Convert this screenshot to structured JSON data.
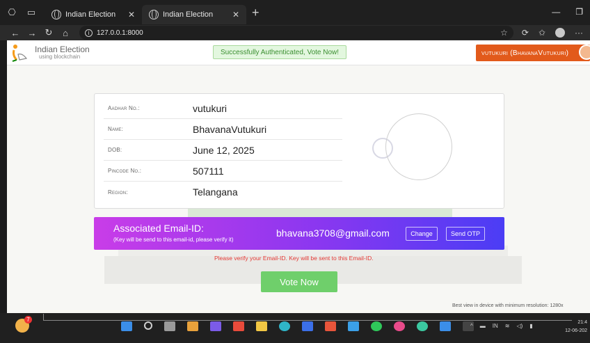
{
  "browser": {
    "tabs": [
      {
        "title": "Indian Election",
        "active": false
      },
      {
        "title": "Indian Election",
        "active": true
      }
    ],
    "url": "127.0.0.1:8000"
  },
  "header": {
    "brand_title": "Indian Election",
    "brand_subtitle": "using blockchain",
    "auth_message": "Successfully Authenticated, Vote Now!",
    "user_badge": "vutukuri (BhavanaVutukuri)"
  },
  "voter": {
    "rows": [
      {
        "label": "Aadhar No.:",
        "value": "vutukuri"
      },
      {
        "label": "Name:",
        "value": "BhavanaVutukuri"
      },
      {
        "label": "DOB:",
        "value": "June 12, 2025"
      },
      {
        "label": "Pincode No.:",
        "value": "507111"
      },
      {
        "label": "Region:",
        "value": "Telangana"
      }
    ]
  },
  "email": {
    "title": "Associated Email-ID:",
    "note": "(Key will be send to this email-id, please verify it)",
    "value": "bhavana3708@gmail.com",
    "change_label": "Change",
    "otp_label": "Send OTP"
  },
  "warning": "Please verify your Email-ID. Key will be sent to this Email-ID.",
  "vote_label": "Vote Now",
  "footer_note": "Best view in device with minimum resolution: 1280x",
  "taskbar": {
    "notification_count": "7",
    "language": "IN",
    "time": "21:4",
    "date": "12-06-202"
  },
  "colors": {
    "accent_orange": "#e25a1b",
    "vote_green": "#6fcf6b",
    "gradient_start": "#c93de8",
    "gradient_end": "#4b3df5"
  }
}
